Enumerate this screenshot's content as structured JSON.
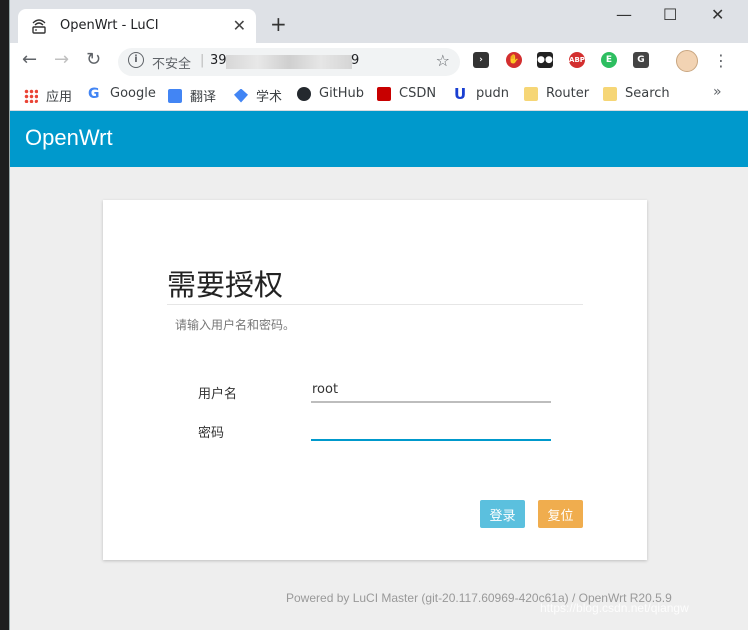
{
  "browser": {
    "tab_title": "OpenWrt - LuCI",
    "tab_close": "✕",
    "new_tab": "+",
    "window_controls": {
      "minimize": "—",
      "maximize": "☐",
      "close": "✕"
    },
    "address": {
      "insecure_label": "不安全",
      "separator": "|",
      "url_prefix": "39",
      "url_suffix": "9"
    },
    "nav": {
      "back": "←",
      "forward": "→",
      "reload": "↻",
      "star": "☆",
      "menu": "⋮"
    },
    "bookmarks": [
      {
        "label": "应用",
        "icon": "apps-grid-icon"
      },
      {
        "label": "Google",
        "icon": "google-icon"
      },
      {
        "label": "翻译",
        "icon": "translate-icon"
      },
      {
        "label": "学术",
        "icon": "scholar-icon"
      },
      {
        "label": "GitHub",
        "icon": "github-icon"
      },
      {
        "label": "CSDN",
        "icon": "csdn-icon"
      },
      {
        "label": "pudn",
        "icon": "pudn-icon"
      },
      {
        "label": "Router",
        "icon": "folder-icon"
      },
      {
        "label": "Search",
        "icon": "folder-icon"
      }
    ],
    "bookmarks_more": "»",
    "extensions": [
      {
        "name": "terminal-ext-icon",
        "color": "#333333",
        "text": "›"
      },
      {
        "name": "stop-ext-icon",
        "color": "#d32f2f",
        "text": "✋"
      },
      {
        "name": "tampermonkey-ext-icon",
        "color": "#222222",
        "text": "●●"
      },
      {
        "name": "adblock-ext-icon",
        "color": "#d32f2f",
        "text": "ABP"
      },
      {
        "name": "evernote-ext-icon",
        "color": "#2dbe60",
        "text": "E"
      },
      {
        "name": "gnu-ext-icon",
        "color": "#444444",
        "text": "G"
      }
    ]
  },
  "page": {
    "brand": "OpenWrt",
    "login": {
      "title": "需要授权",
      "description": "请输入用户名和密码。",
      "username_label": "用户名",
      "username_value": "root",
      "password_label": "密码",
      "password_value": "",
      "login_button": "登录",
      "reset_button": "复位"
    },
    "footer": "Powered by LuCI Master (git-20.117.60969-420c61a) / OpenWrt R20.5.9",
    "watermark": "https://blog.csdn.net/qiangw"
  },
  "colors": {
    "header": "#0099cc",
    "login_button": "#5bc0de",
    "reset_button": "#f0ad4e"
  }
}
